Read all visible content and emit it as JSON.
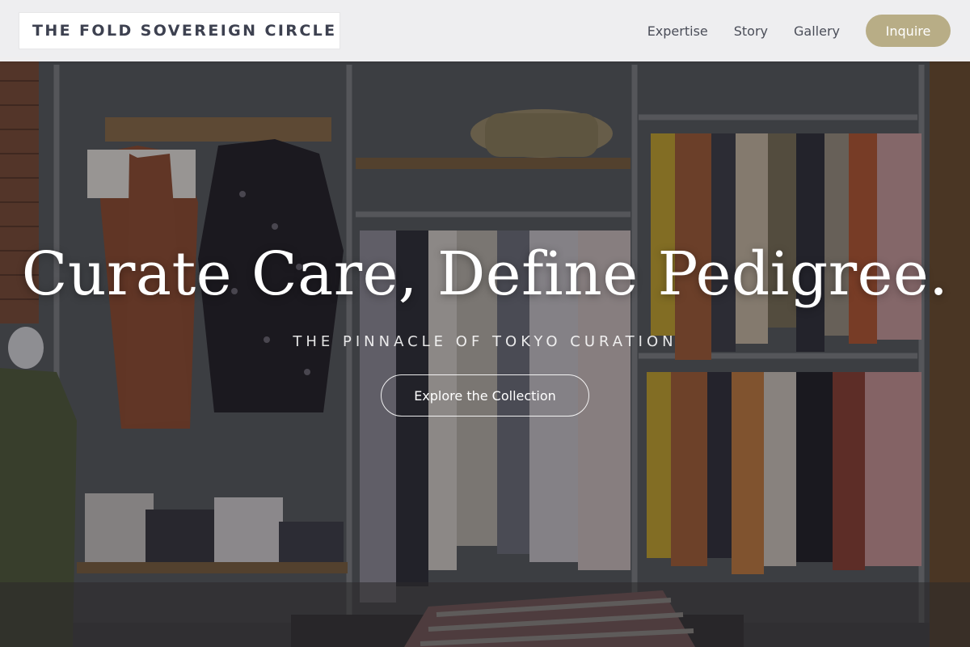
{
  "header": {
    "brand": "THE FOLD SOVEREIGN CIRCLE",
    "nav": [
      {
        "label": "Expertise"
      },
      {
        "label": "Story"
      },
      {
        "label": "Gallery"
      }
    ],
    "cta_label": "Inquire"
  },
  "hero": {
    "title": "Curate Care, Define Pedigree.",
    "subtitle": "THE PINNACLE OF TOKYO CURATION",
    "button_label": "Explore the Collection"
  },
  "colors": {
    "header_bg": "#f6f6f8",
    "brand_text": "#3d4150",
    "accent": "#b8ad86",
    "hero_text": "#ffffff"
  }
}
